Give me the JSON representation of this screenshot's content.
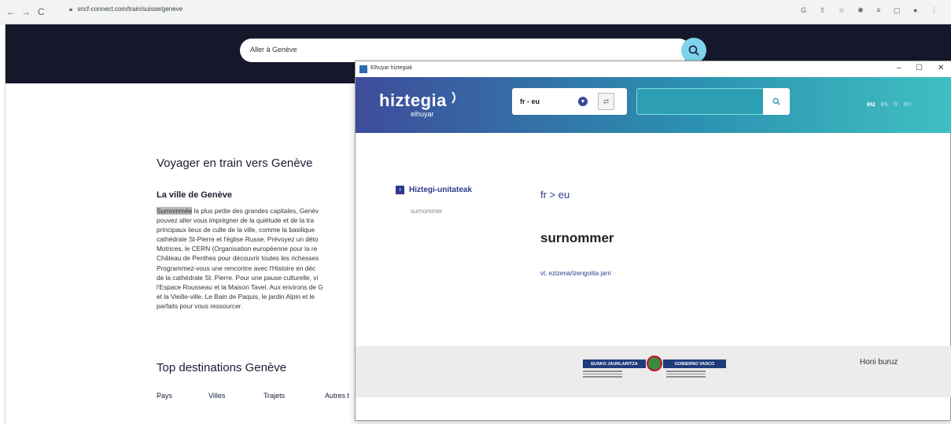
{
  "browser": {
    "url": "sncf-connect.com/train/suisse/geneve",
    "nav_back": "←",
    "nav_forward": "→",
    "nav_reload": "C",
    "toolbar_icons": "G ⇪ ☆ ✱ ≡ ▢ ● ⋮"
  },
  "site": {
    "search_text": "Aller à Genève",
    "heading": "Voyager en train vers Genève",
    "subheading": "La ville de Genève",
    "paragraph_highlight": "Surnommée",
    "paragraph_line1_rest": " la plus petite des grandes capitales, Genèv",
    "paragraph_lines": [
      "pouvez aller vous imprégner de la quiétude et de la tra",
      "principaux lieux de culte de la ville, comme la basilique",
      "cathédrale St-Pierre et l'église Russe. Prévoyez un déto",
      "Motrices, le CERN (Organisation européenne pour la re",
      "Château de Penthes pour découvrir toutes les richesses",
      "Programmez-vous une rencontre avec l'Histoire en déc",
      "de la cathédrale St. Pierre. Pour une pause culturelle, vi",
      "l'Espace Rousseau et la Maison Tavel. Aux environs de G",
      "et la Vieille-ville. Le Bain de Paquis, le jardin Alpin et le",
      "parfaits pour vous ressourcer."
    ],
    "top_heading": "Top destinations Genève",
    "filters": [
      "Pays",
      "Villes",
      "Trajets",
      "Autres t"
    ],
    "filter_chevron": "⌄"
  },
  "dict_window": {
    "title": "Elhuyar hiztegiak",
    "controls": [
      "–",
      "☐",
      "✕"
    ],
    "logo": "hiztegia",
    "logo_sub": "elhuyar",
    "language_pair_select": "fr - eu",
    "search_value": "",
    "ui_languages": [
      "eu",
      "es",
      "fr",
      "en"
    ],
    "active_language": "eu",
    "sidebar_label": "Hiztegi-unitateak",
    "sidebar_entry": "surnommer",
    "direction": "fr > eu",
    "headword": "surnommer",
    "definition": "vt. ezizena/izengoitia jarri",
    "footer_logo_left": "EUSKO JAURLARITZA",
    "footer_logo_right": "GOBIERNO VASCO",
    "footer_about": "Honi buruz"
  },
  "colors": {
    "site_header": "#15182a",
    "search_button": "#7fd3ec",
    "dict_gradient_start": "#3e4c9c",
    "dict_gradient_end": "#3fbfc2",
    "dict_accent": "#2d3a8c"
  }
}
